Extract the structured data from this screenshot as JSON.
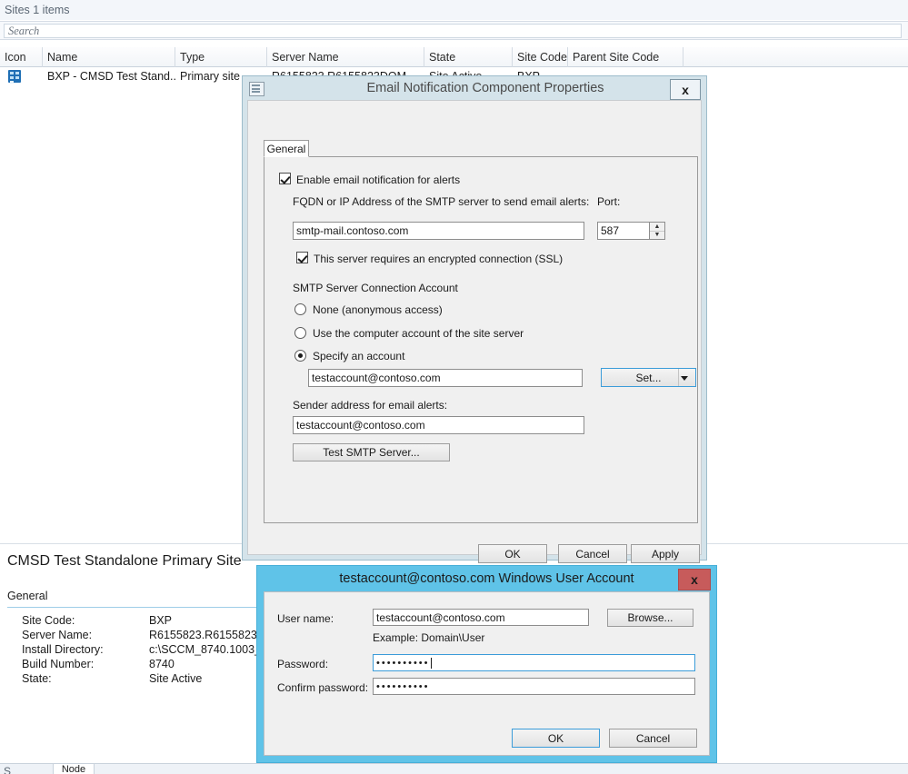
{
  "console": {
    "header_title": "Sites 1 items",
    "search": {
      "placeholder": "Search",
      "value": ""
    },
    "grid": {
      "columns": [
        "Icon",
        "Name",
        "Type",
        "Server Name",
        "State",
        "Site Code",
        "Parent Site Code"
      ],
      "rows": [
        {
          "icon": "site-icon",
          "name": "BXP - CMSD Test Stand...",
          "type": "Primary site",
          "server_name": "R6155823.R6155823DOM...",
          "state": "Site Active",
          "site_code": "BXP",
          "parent_site_code": ""
        }
      ]
    },
    "detail": {
      "title": "CMSD Test Standalone Primary Site",
      "section": "General",
      "fields": [
        {
          "label": "Site Code:",
          "value": "BXP"
        },
        {
          "label": "Server Name:",
          "value": "R6155823.R61558231"
        },
        {
          "label": "Install Directory:",
          "value": "c:\\SCCM_8740.1003_"
        },
        {
          "label": "Build Number:",
          "value": "8740"
        },
        {
          "label": "State:",
          "value": "Site Active"
        }
      ]
    },
    "bottom": {
      "tab_label": "Node",
      "left_text": "S"
    }
  },
  "email_dialog": {
    "title": "Email Notification Component Properties",
    "icon": "window-app-icon",
    "close_label": "x",
    "tab": "General",
    "enable_checkbox": {
      "label": "Enable email notification for alerts",
      "checked": true
    },
    "smtp_label": "FQDN or IP Address of the SMTP server to send email alerts:",
    "smtp_value": "smtp-mail.contoso.com",
    "port_label": "Port:",
    "port_value": "587",
    "ssl_checkbox": {
      "label": "This server requires an encrypted connection (SSL)",
      "checked": true
    },
    "account_group_label": "SMTP Server Connection Account",
    "radios": [
      {
        "label": "None (anonymous access)",
        "selected": false
      },
      {
        "label": "Use the computer account of the site server",
        "selected": false
      },
      {
        "label": "Specify an account",
        "selected": true
      }
    ],
    "account_value": "testaccount@contoso.com",
    "set_button": "Set...",
    "sender_label": "Sender address for email alerts:",
    "sender_value": "testaccount@contoso.com",
    "test_button": "Test SMTP Server...",
    "footer": {
      "ok": "OK",
      "cancel": "Cancel",
      "apply": "Apply"
    }
  },
  "user_dialog": {
    "title": "testaccount@contoso.com Windows User Account",
    "close_label": "x",
    "username_label": "User name:",
    "username_value": "testaccount@contoso.com",
    "browse_button": "Browse...",
    "example_text": "Example: Domain\\User",
    "password_label": "Password:",
    "password_value": "••••••••••",
    "confirm_label": "Confirm password:",
    "confirm_value": "••••••••••",
    "footer": {
      "ok": "OK",
      "cancel": "Cancel"
    }
  },
  "colors": {
    "active_title": "#5fc3e8",
    "inactive_title": "#d4e3ea",
    "close_red": "#c75b5b",
    "focus_blue": "#3b9cd9"
  }
}
